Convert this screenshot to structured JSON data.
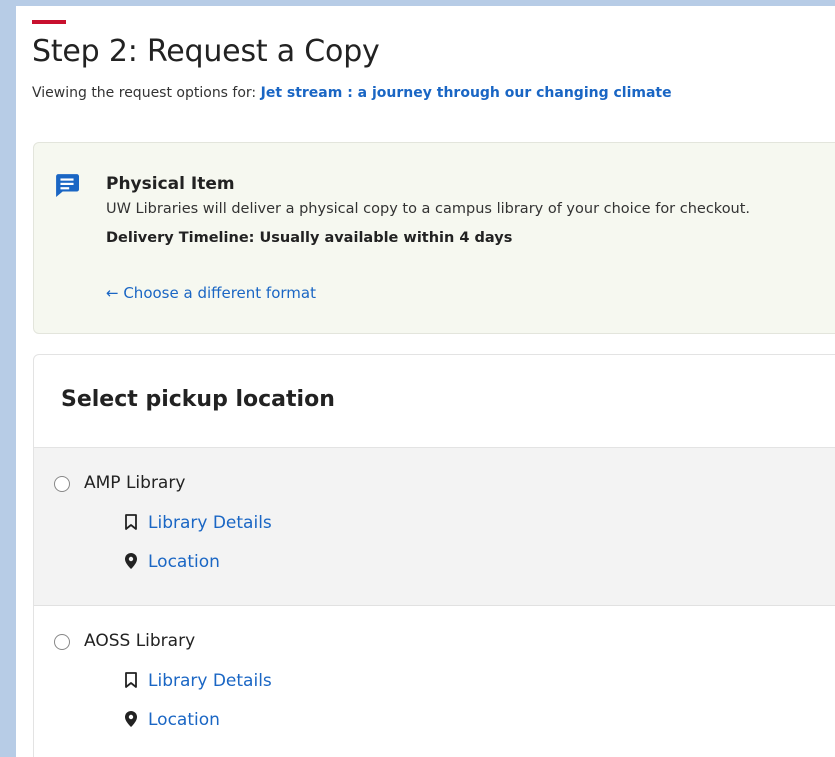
{
  "header": {
    "title": "Step 2: Request a Copy",
    "subtitle_prefix": "Viewing the request options for:",
    "item_title": "Jet stream : a journey through our changing climate"
  },
  "format": {
    "icon": "message-icon",
    "title": "Physical Item",
    "description": "UW Libraries will deliver a physical copy to a campus library of your choice for checkout.",
    "timeline": "Delivery Timeline: Usually available within 4 days",
    "change_link": "← Choose a different format"
  },
  "pickup": {
    "title": "Select pickup location",
    "options": [
      {
        "label": "AMP Library",
        "details_link": "Library Details",
        "location_link": "Location"
      },
      {
        "label": "AOSS Library",
        "details_link": "Library Details",
        "location_link": "Location"
      }
    ]
  },
  "colors": {
    "accent": "#c8102e",
    "link": "#1a66c4",
    "frame": "#b7cce6"
  }
}
